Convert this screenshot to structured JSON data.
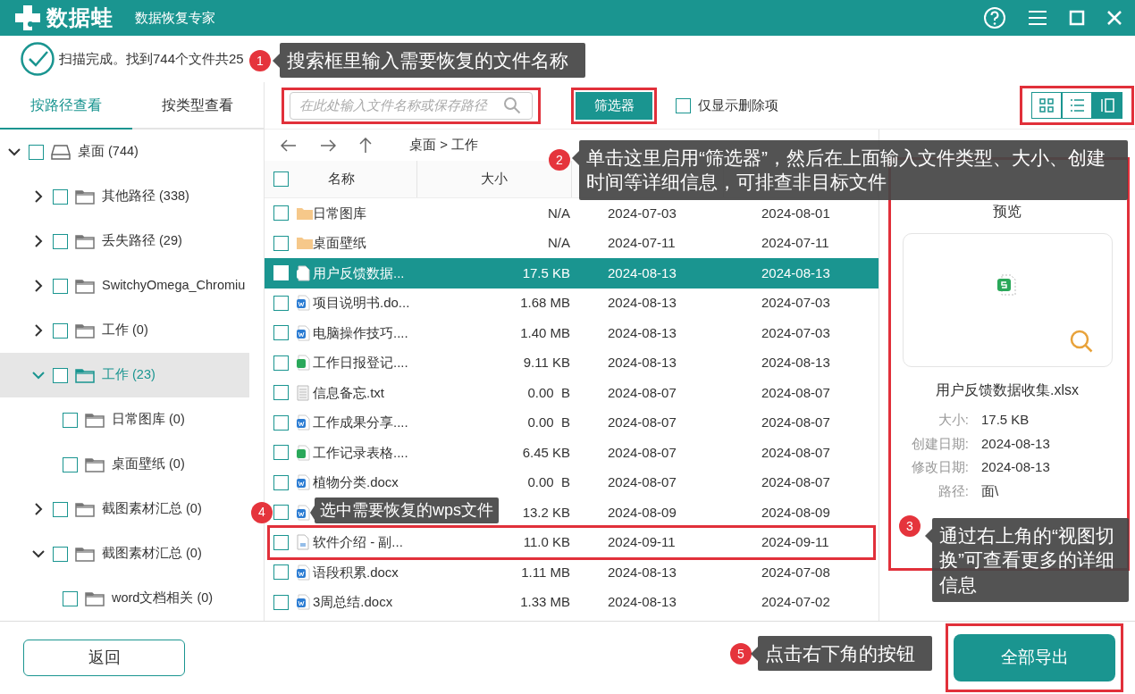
{
  "app": {
    "logo": "数据蛙",
    "title": "数据恢复专家"
  },
  "status": "扫描完成。找到744个文件共25",
  "view_tabs": [
    {
      "label": "按路径查看",
      "selected": true
    },
    {
      "label": "按类型查看",
      "selected": false
    }
  ],
  "tree": [
    {
      "label": "桌面 (744)",
      "kind": "drive",
      "expanded": true,
      "checked": false,
      "selected": false,
      "children": [
        {
          "label": "其他路径 (338)",
          "kind": "folder",
          "expanded": false,
          "checked": false,
          "selected": false
        },
        {
          "label": "丢失路径 (29)",
          "kind": "folder",
          "expanded": false,
          "checked": false,
          "selected": false
        },
        {
          "label": "SwitchyOmega_Chromiu",
          "kind": "folder",
          "expanded": false,
          "checked": false,
          "selected": false
        },
        {
          "label": "工作 (0)",
          "kind": "folder",
          "expanded": false,
          "checked": false,
          "selected": false
        },
        {
          "label": "工作 (23)",
          "kind": "folder",
          "expanded": true,
          "checked": false,
          "selected": true,
          "children": [
            {
              "label": "日常图库 (0)",
              "kind": "folder",
              "checked": false,
              "selected": false
            },
            {
              "label": "桌面壁纸 (0)",
              "kind": "folder",
              "checked": false,
              "selected": false
            }
          ]
        },
        {
          "label": "截图素材汇总 (0)",
          "kind": "folder",
          "expanded": false,
          "checked": false,
          "selected": false
        },
        {
          "label": "截图素材汇总 (0)",
          "kind": "folder",
          "expanded": true,
          "checked": false,
          "selected": false,
          "children": [
            {
              "label": "word文档相关 (0)",
              "kind": "folder",
              "checked": false,
              "selected": false
            }
          ]
        }
      ]
    }
  ],
  "search": {
    "placeholder": "在此处输入文件名称或保存路径"
  },
  "filter_button": "筛选器",
  "deleted_only": {
    "label": "仅显示删除项",
    "checked": false
  },
  "view_modes": [
    {
      "kind": "grid",
      "selected": false
    },
    {
      "kind": "list",
      "selected": false
    },
    {
      "kind": "preview",
      "selected": true
    }
  ],
  "breadcrumb": "桌面 > 工作",
  "table": {
    "columns": [
      "名称",
      "大小"
    ],
    "select_all": {
      "checked": false
    },
    "rows": [
      {
        "kind": "folder",
        "name": "日常图库",
        "size": "N/A",
        "created": "2024-07-03",
        "modified": "2024-08-01",
        "checked": false,
        "selected": false
      },
      {
        "kind": "folder",
        "name": "桌面壁纸",
        "size": "N/A",
        "created": "2024-07-11",
        "modified": "2024-07-11",
        "checked": false,
        "selected": false
      },
      {
        "kind": "sheet",
        "name": "用户反馈数据...",
        "size": "17.5 KB",
        "created": "2024-08-13",
        "modified": "2024-08-13",
        "checked": false,
        "selected": true
      },
      {
        "kind": "doc",
        "name": "项目说明书.do...",
        "size": "1.68 MB",
        "created": "2024-08-13",
        "modified": "2024-07-03",
        "checked": false,
        "selected": false
      },
      {
        "kind": "doc",
        "name": "电脑操作技巧....",
        "size": "1.40 MB",
        "created": "2024-08-13",
        "modified": "2024-07-03",
        "checked": false,
        "selected": false
      },
      {
        "kind": "sheet",
        "name": "工作日报登记....",
        "size": "9.11 KB",
        "created": "2024-08-13",
        "modified": "2024-08-13",
        "checked": false,
        "selected": false
      },
      {
        "kind": "text",
        "name": "信息备忘.txt",
        "size": "0.00  B",
        "created": "2024-08-07",
        "modified": "2024-08-07",
        "checked": false,
        "selected": false
      },
      {
        "kind": "doc",
        "name": "工作成果分享....",
        "size": "0.00  B",
        "created": "2024-08-07",
        "modified": "2024-08-07",
        "checked": false,
        "selected": false
      },
      {
        "kind": "sheet",
        "name": "工作记录表格....",
        "size": "6.45 KB",
        "created": "2024-08-07",
        "modified": "2024-08-07",
        "checked": false,
        "selected": false
      },
      {
        "kind": "doc",
        "name": "植物分类.docx",
        "size": "0.00  B",
        "created": "2024-08-07",
        "modified": "2024-08-07",
        "checked": false,
        "selected": false
      },
      {
        "kind": "doc",
        "size": "13.2 KB",
        "created": "2024-08-09",
        "modified": "2024-08-09",
        "checked": false,
        "selected": false
      },
      {
        "kind": "plain",
        "name": "软件介绍 - 副...",
        "size": "11.0 KB",
        "created": "2024-09-11",
        "modified": "2024-09-11",
        "checked": false,
        "selected": false
      },
      {
        "kind": "doc",
        "name": "语段积累.docx",
        "size": "1.11 MB",
        "created": "2024-08-13",
        "modified": "2024-07-08",
        "checked": false,
        "selected": false
      },
      {
        "kind": "doc",
        "name": "3周总结.docx",
        "size": "1.33 MB",
        "created": "2024-08-13",
        "modified": "2024-07-02",
        "checked": false,
        "selected": false
      }
    ]
  },
  "preview": {
    "title": "预览",
    "file_name": "用户反馈数据收集.xlsx",
    "details": [
      {
        "label": "大小:",
        "value": "17.5 KB"
      },
      {
        "label": "创建日期:",
        "value": "2024-08-13"
      },
      {
        "label": "修改日期:",
        "value": "2024-08-13"
      },
      {
        "label": "路径:",
        "value": "面\\"
      }
    ]
  },
  "back_button": "返回",
  "export_button": "全部导出",
  "annotations": [
    {
      "number": "1",
      "text": "搜索框里输入需要恢复的文件名称"
    },
    {
      "number": "2",
      "text": "单击这里启用“筛选器”，然后在上面输入文件类型、大小、创建时间等详细信息，可排查非目标文件"
    },
    {
      "number": "3",
      "text": "通过右上角的“视图切换”可查看更多的详细信息"
    },
    {
      "number": "4",
      "text": "选中需要恢复的wps文件"
    },
    {
      "number": "5",
      "text": "点击右下角的按钮"
    }
  ]
}
